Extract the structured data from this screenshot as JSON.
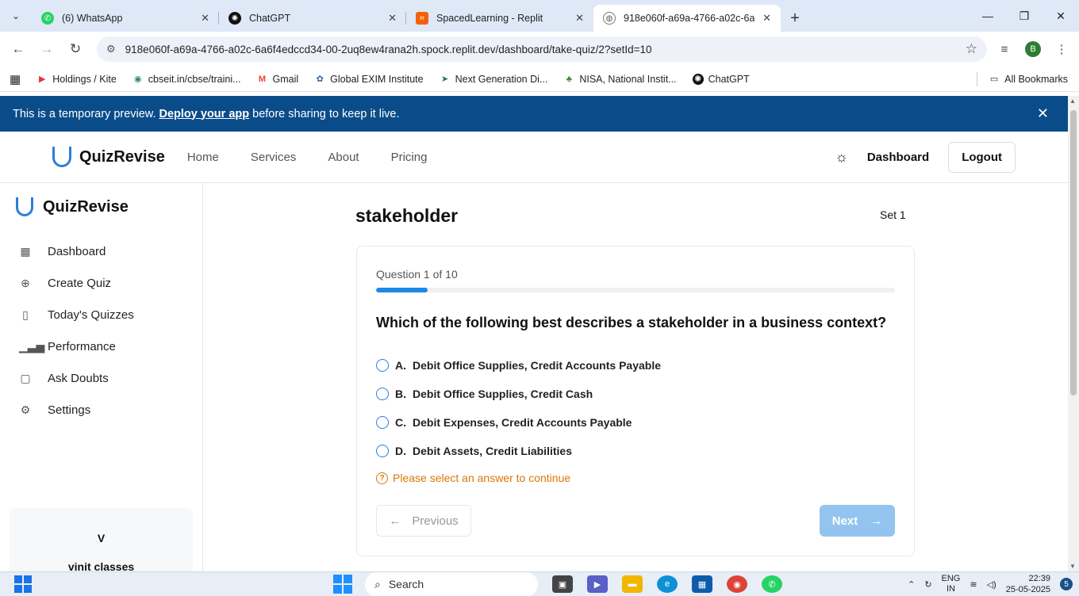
{
  "browser": {
    "tabs": [
      {
        "title": "(6) WhatsApp",
        "icon": "whatsapp-icon",
        "color": "#25d366"
      },
      {
        "title": "ChatGPT",
        "icon": "chatgpt-icon",
        "color": "#111111"
      },
      {
        "title": "SpacedLearning - Replit",
        "icon": "replit-icon",
        "color": "#f26207"
      },
      {
        "title": "918e060f-a69a-4766-a02c-6a6f",
        "icon": "globe-icon",
        "color": "#555555"
      }
    ],
    "url": "918e060f-a69a-4766-a02c-6a6f4edccd34-00-2uq8ew4rana2h.spock.replit.dev/dashboard/take-quiz/2?setId=10",
    "profile_initial": "B",
    "bookmarks": [
      {
        "label": "Holdings / Kite",
        "icon": "kite-icon"
      },
      {
        "label": "cbseit.in/cbse/traini...",
        "icon": "cbse-icon"
      },
      {
        "label": "Gmail",
        "icon": "gmail-icon"
      },
      {
        "label": "Global EXIM Institute",
        "icon": "exim-icon"
      },
      {
        "label": "Next Generation Di...",
        "icon": "arrow-icon"
      },
      {
        "label": "NISA, National Instit...",
        "icon": "nisa-icon"
      },
      {
        "label": "ChatGPT",
        "icon": "chatgpt-icon"
      }
    ],
    "all_bookmarks": "All Bookmarks"
  },
  "banner": {
    "prefix": "This is a temporary preview.",
    "link": "Deploy your app",
    "suffix": "before sharing to keep it live."
  },
  "header": {
    "brand": "QuizRevise",
    "nav": [
      "Home",
      "Services",
      "About",
      "Pricing"
    ],
    "dashboard": "Dashboard",
    "logout": "Logout"
  },
  "sidebar": {
    "brand": "QuizRevise",
    "items": [
      {
        "label": "Dashboard",
        "icon": "grid-icon"
      },
      {
        "label": "Create Quiz",
        "icon": "plus-circle-icon"
      },
      {
        "label": "Today's Quizzes",
        "icon": "book-icon"
      },
      {
        "label": "Performance",
        "icon": "bar-chart-icon"
      },
      {
        "label": "Ask Doubts",
        "icon": "message-icon"
      },
      {
        "label": "Settings",
        "icon": "gear-icon"
      }
    ],
    "user_initial": "V",
    "org": "vinit classes"
  },
  "quiz": {
    "title": "stakeholder",
    "set": "Set 1",
    "progress_label": "Question 1 of 10",
    "progress_fraction": 0.1,
    "question": "Which of the following best describes a stakeholder in a business context?",
    "options": [
      {
        "letter": "A.",
        "text": "Debit Office Supplies, Credit Accounts Payable"
      },
      {
        "letter": "B.",
        "text": "Debit Office Supplies, Credit Cash"
      },
      {
        "letter": "C.",
        "text": "Debit Expenses, Credit Accounts Payable"
      },
      {
        "letter": "D.",
        "text": "Debit Assets, Credit Liabilities"
      }
    ],
    "warning": "Please select an answer to continue",
    "prev": "Previous",
    "next": "Next"
  },
  "taskbar": {
    "search": "Search",
    "lang_top": "ENG",
    "lang_bottom": "IN",
    "time": "22:39",
    "date": "25-05-2025",
    "notifications": "5"
  },
  "colors": {
    "accent": "#1e88e5",
    "banner": "#0a4c89",
    "warning": "#d97706",
    "next_disabled": "#93c4ef"
  }
}
